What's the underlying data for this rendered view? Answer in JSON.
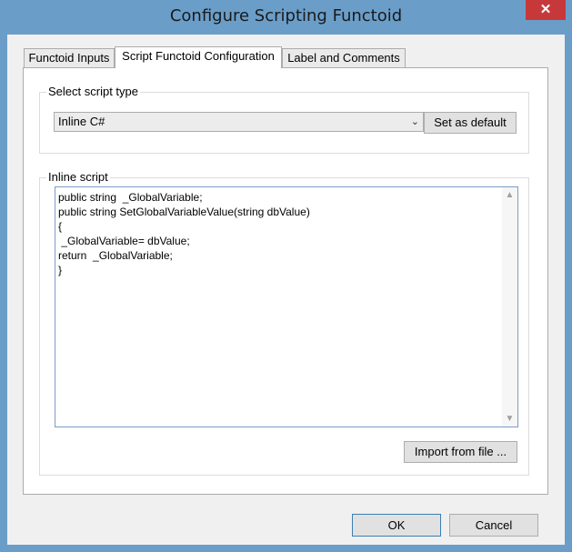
{
  "window": {
    "title": "Configure Scripting Functoid",
    "close_glyph": "✕"
  },
  "tabs": [
    {
      "label": "Functoid Inputs"
    },
    {
      "label": "Script Functoid Configuration"
    },
    {
      "label": "Label and Comments"
    }
  ],
  "script_type_group": {
    "legend": "Select script type",
    "selected": "Inline C#",
    "set_default_label": "Set as default"
  },
  "inline_script_group": {
    "legend": "Inline script",
    "code": "public string  _GlobalVariable;\npublic string SetGlobalVariableValue(string dbValue)\n{\n _GlobalVariable= dbValue;\nreturn  _GlobalVariable;\n}",
    "import_label": "Import from file ..."
  },
  "footer": {
    "ok_label": "OK",
    "cancel_label": "Cancel"
  },
  "icons": {
    "dropdown": "chevron-down-icon",
    "scroll_up": "scroll-up-icon",
    "scroll_down": "scroll-down-icon",
    "close": "close-icon"
  },
  "colors": {
    "title_bar": "#6a9ec9",
    "close_button": "#c7383b",
    "editor_border": "#7a9cc7"
  }
}
